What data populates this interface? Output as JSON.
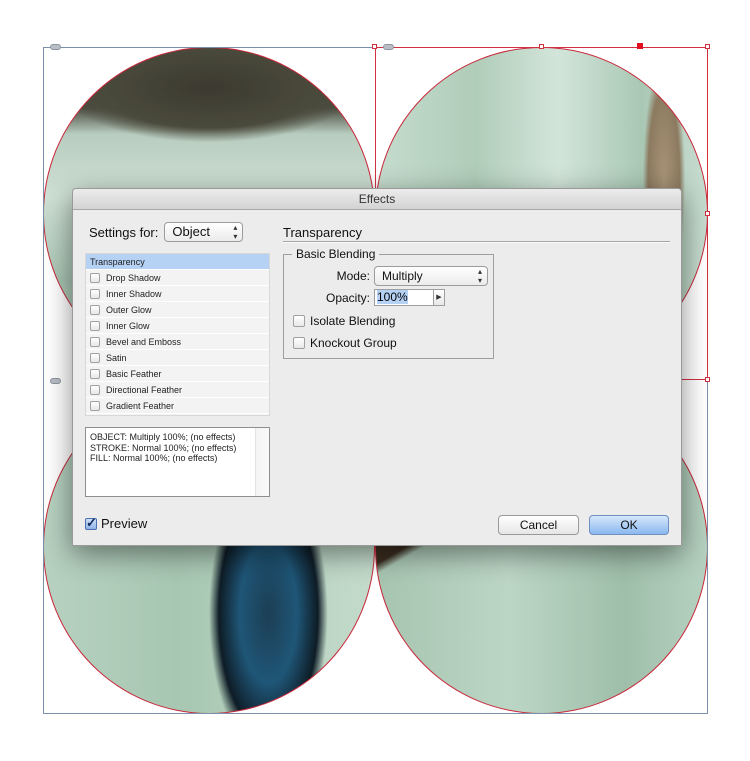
{
  "dialog": {
    "title": "Effects",
    "settings_for_label": "Settings for:",
    "settings_for_value": "Object",
    "effects": [
      {
        "label": "Transparency",
        "selected": true,
        "checkbox": false
      },
      {
        "label": "Drop Shadow",
        "checked": false
      },
      {
        "label": "Inner Shadow",
        "checked": false
      },
      {
        "label": "Outer Glow",
        "checked": false
      },
      {
        "label": "Inner Glow",
        "checked": false
      },
      {
        "label": "Bevel and Emboss",
        "checked": false
      },
      {
        "label": "Satin",
        "checked": false
      },
      {
        "label": "Basic Feather",
        "checked": false
      },
      {
        "label": "Directional Feather",
        "checked": false
      },
      {
        "label": "Gradient Feather",
        "checked": false
      }
    ],
    "summary_lines": [
      "OBJECT: Multiply 100%; (no effects)",
      "STROKE: Normal 100%; (no effects)",
      "FILL: Normal 100%; (no effects)"
    ],
    "preview_label": "Preview",
    "preview_checked": true,
    "section_title": "Transparency",
    "group_title": "Basic Blending",
    "mode_label": "Mode:",
    "mode_value": "Multiply",
    "opacity_label": "Opacity:",
    "opacity_value": "100%",
    "isolate_blending_label": "Isolate Blending",
    "isolate_blending_checked": false,
    "knockout_group_label": "Knockout Group",
    "knockout_group_checked": false,
    "cancel_label": "Cancel",
    "ok_label": "OK"
  },
  "icons": {
    "popup_arrows": "▴▾",
    "stepper_arrow": "▶"
  },
  "colors": {
    "selection_red": "#d23040",
    "frame_blue": "#7a8fa8",
    "selected_row": "#b5d2f5",
    "ok_button": "#8ab8ef"
  }
}
